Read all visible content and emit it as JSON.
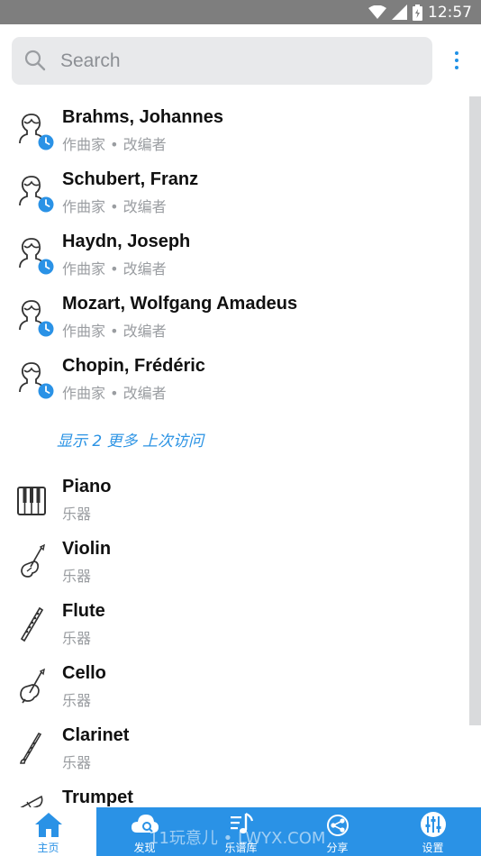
{
  "status_bar": {
    "time": "12:57",
    "icons": [
      "wifi-icon",
      "signal-icon",
      "battery-icon"
    ]
  },
  "search": {
    "placeholder": "Search"
  },
  "recent": [
    {
      "name": "Brahms, Johannes",
      "role": "作曲家 • 改编者"
    },
    {
      "name": "Schubert, Franz",
      "role": "作曲家 • 改编者"
    },
    {
      "name": "Haydn, Joseph",
      "role": "作曲家 • 改编者"
    },
    {
      "name": "Mozart, Wolfgang Amadeus",
      "role": "作曲家 • 改编者"
    },
    {
      "name": "Chopin, Frédéric",
      "role": "作曲家 • 改编者"
    }
  ],
  "show_more": "显示 2 更多 上次访问",
  "instruments": [
    {
      "name": "Piano",
      "type": "乐器",
      "icon": "piano-icon"
    },
    {
      "name": "Violin",
      "type": "乐器",
      "icon": "violin-icon"
    },
    {
      "name": "Flute",
      "type": "乐器",
      "icon": "flute-icon"
    },
    {
      "name": "Cello",
      "type": "乐器",
      "icon": "cello-icon"
    },
    {
      "name": "Clarinet",
      "type": "乐器",
      "icon": "clarinet-icon"
    },
    {
      "name": "Trumpet",
      "type": "",
      "icon": "trumpet-icon"
    }
  ],
  "tabs": [
    {
      "label": "主页",
      "icon": "home-icon",
      "active": true
    },
    {
      "label": "发现",
      "icon": "cloud-search-icon",
      "active": false
    },
    {
      "label": "乐谱库",
      "icon": "music-library-icon",
      "active": false
    },
    {
      "label": "分享",
      "icon": "share-icon",
      "active": false
    },
    {
      "label": "设置",
      "icon": "settings-sliders-icon",
      "active": false
    }
  ],
  "watermark": "11玩意儿 • LWYX.COM",
  "colors": {
    "accent": "#2a92e6",
    "status_bar": "#7e7e7e",
    "subtitle": "#9a9da1"
  }
}
